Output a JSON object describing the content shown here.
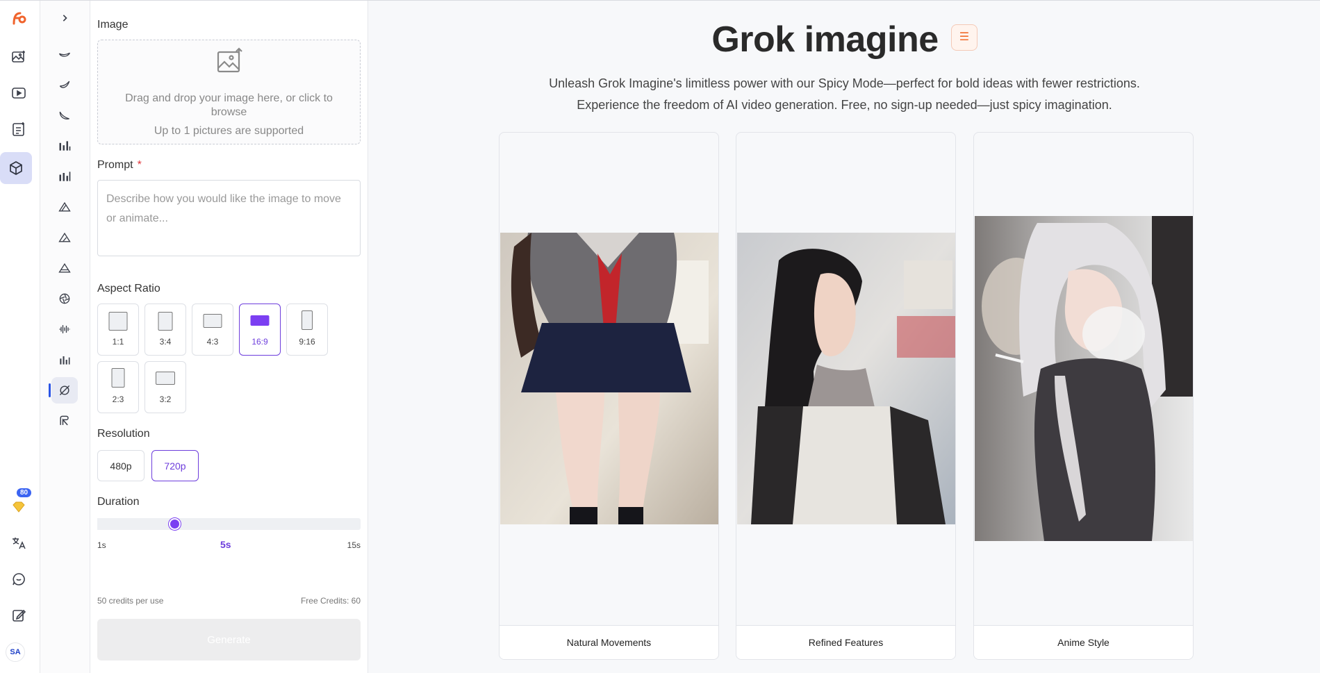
{
  "panel": {
    "image_label": "Image",
    "drop_text": "Drag and drop your image here, or click to browse",
    "drop_limit": "Up to 1 pictures are supported",
    "prompt_label": "Prompt",
    "required_mark": "*",
    "prompt_placeholder": "Describe how you would like the image to move or animate...",
    "aspect_label": "Aspect Ratio",
    "ratios": [
      "1:1",
      "3:4",
      "4:3",
      "16:9",
      "9:16",
      "2:3",
      "3:2"
    ],
    "selected_ratio": "16:9",
    "resolution_label": "Resolution",
    "resolutions": [
      "480p",
      "720p"
    ],
    "selected_resolution": "720p",
    "duration_label": "Duration",
    "duration_min": "1s",
    "duration_value": "5s",
    "duration_max": "15s",
    "duration_fraction": 0.2857,
    "credits_per_use": "50 credits per use",
    "free_credits": "Free Credits: 60",
    "generate_label": "Generate"
  },
  "rail": {
    "badge": "80",
    "avatar": "SA",
    "icons": [
      "logo-icon",
      "image-gallery-icon",
      "video-icon",
      "document-icon",
      "cube-icon",
      "gem-icon",
      "translate-icon",
      "chat-icon",
      "edit-icon"
    ]
  },
  "main": {
    "title": "Grok imagine",
    "description_line1": "Unleash Grok Imagine's limitless power with our Spicy Mode—perfect for bold ideas with fewer restrictions.",
    "description_line2": "Experience the freedom of AI video generation. Free, no sign-up needed—just spicy imagination.",
    "cards": [
      {
        "caption": "Natural Movements"
      },
      {
        "caption": "Refined Features"
      },
      {
        "caption": "Anime Style"
      }
    ]
  },
  "colors": {
    "accent": "#7b3ff2",
    "brand": "#f06b2b",
    "active_rail": "#d9ddf7"
  }
}
